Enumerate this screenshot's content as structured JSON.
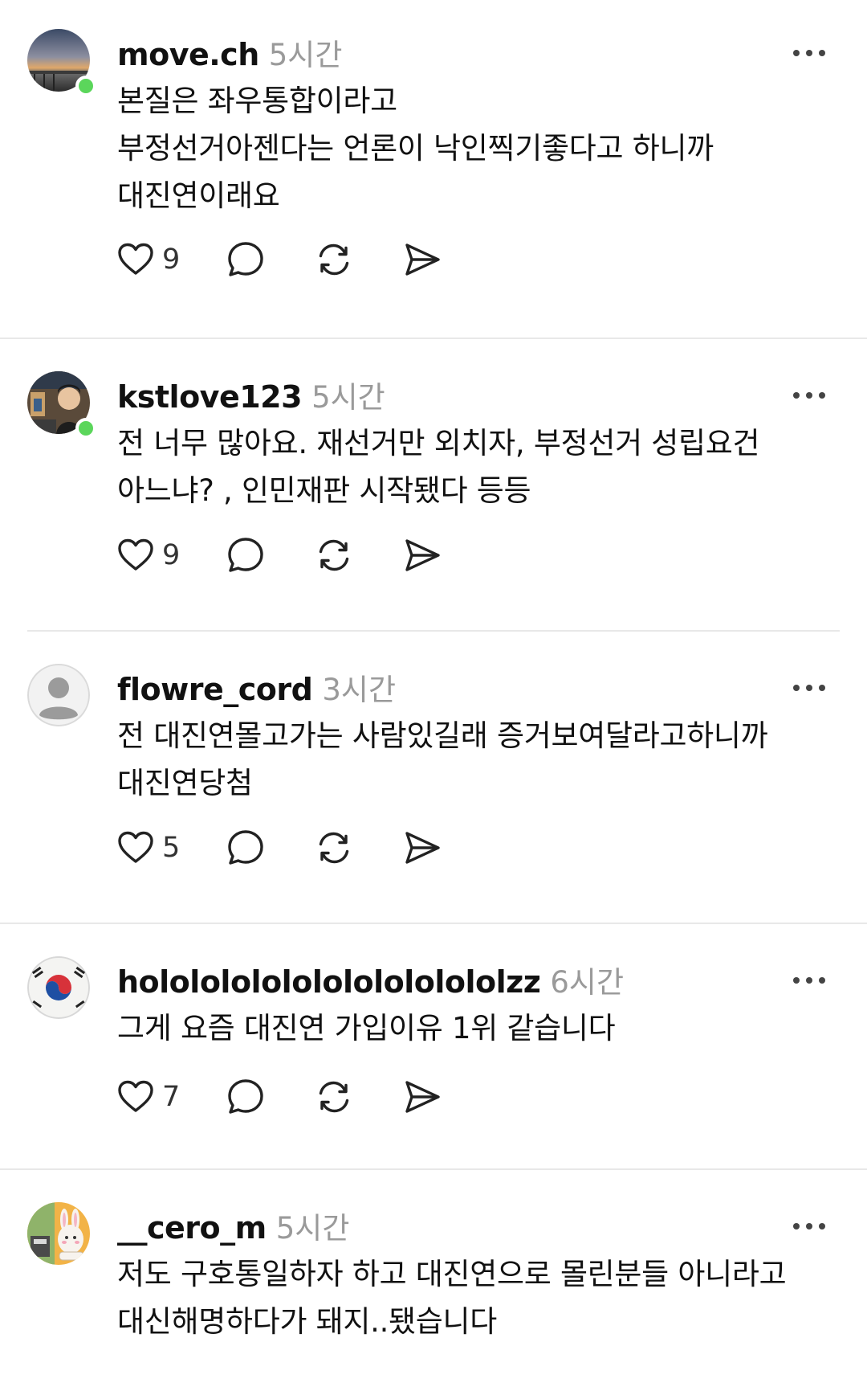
{
  "posts": [
    {
      "username": "move.ch",
      "time": "5시간",
      "online": true,
      "lines": [
        "본질은 좌우통합이라고",
        "부정선거아젠다는 언론이 낙인찍기좋다고 하니까",
        "대진연이래요"
      ],
      "likes": "9"
    },
    {
      "username": "kstlove123",
      "time": "5시간",
      "online": true,
      "lines": [
        "전 너무 많아요. 재선거만 외치자, 부정선거 성립요건",
        "아느냐? , 인민재판 시작됐다 등등"
      ],
      "likes": "9"
    },
    {
      "username": "flowre_cord",
      "time": "3시간",
      "online": false,
      "lines": [
        "전 대진연몰고가는 사람있길래 증거보여달라고하니까",
        "대진연당첨"
      ],
      "likes": "5"
    },
    {
      "username": "hololololololololololololzz",
      "time": "6시간",
      "online": false,
      "lines": [
        "그게 요즘 대진연 가입이유 1위 같습니다"
      ],
      "likes": "7"
    },
    {
      "username": "__cero_m",
      "time": "5시간",
      "online": false,
      "lines": [
        "저도 구호통일하자 하고 대진연으로 몰린분들 아니라고",
        "대신해명하다가 돼지..됐습니다"
      ],
      "likes": ""
    }
  ],
  "icons": {
    "like": "heart-icon",
    "reply": "comment-icon",
    "repost": "repost-icon",
    "share": "send-icon",
    "more": "more-dots-icon"
  },
  "colors": {
    "online": "#5bd65b",
    "time": "#9a9a9a",
    "separator": "#e8e8e8"
  }
}
